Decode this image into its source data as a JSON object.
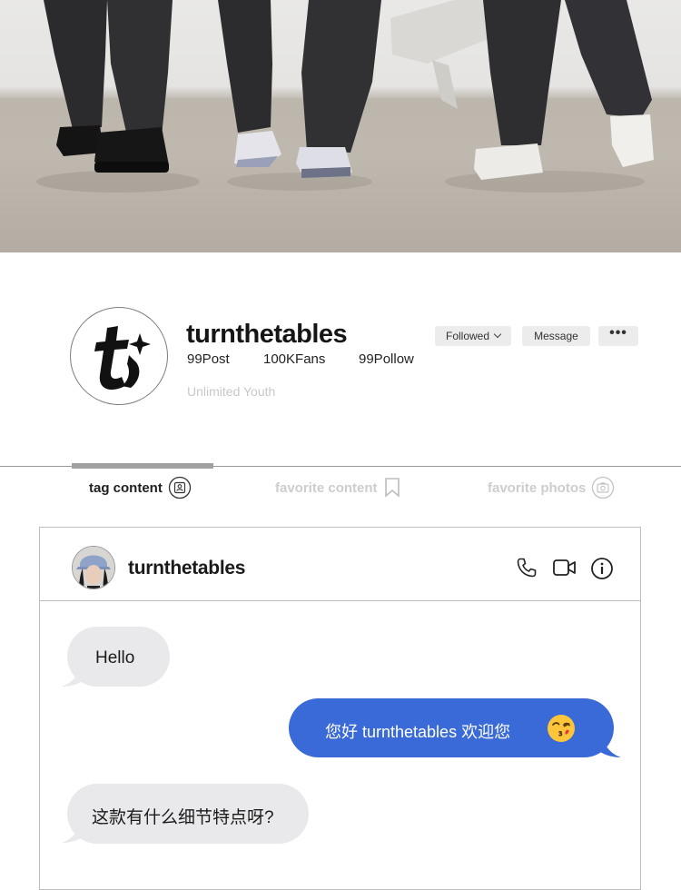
{
  "profile": {
    "username": "turnthetables",
    "posts": "99Post",
    "fans": "100KFans",
    "follow": "99Pollow",
    "tagline": "Unlimited Youth",
    "followed_label": "Followed",
    "message_label": "Message",
    "more_label": "•••",
    "logo_icon": "turnthetables-logo-icon"
  },
  "tabs": [
    {
      "label": "tag content",
      "icon": "tag-user-icon",
      "active": true
    },
    {
      "label": "favorite content",
      "icon": "bookmark-icon",
      "active": false
    },
    {
      "label": "favorite photos",
      "icon": "camera-icon",
      "active": false
    }
  ],
  "chat": {
    "contact_name": "turnthetables",
    "header_icons": [
      "phone-icon",
      "video-icon",
      "info-icon"
    ],
    "messages": [
      {
        "side": "incoming",
        "text": "Hello"
      },
      {
        "side": "outgoing",
        "text": "您好 turnthetables 欢迎您",
        "emoji": "kissing-face-emoji"
      },
      {
        "side": "incoming",
        "text": "这款有什么细节特点呀?"
      }
    ]
  },
  "colors": {
    "outgoing_bubble": "#3a6ad8",
    "incoming_bubble": "#e9e9eb",
    "muted_text": "#cdcdcd",
    "button_bg": "#ececec"
  }
}
